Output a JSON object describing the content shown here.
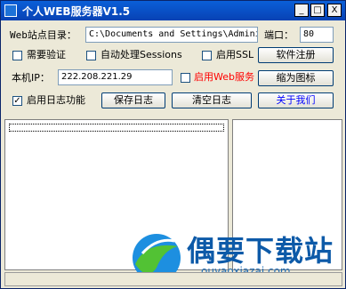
{
  "window": {
    "title": "个人WEB服务器V1.5"
  },
  "controls": {
    "minimize": "_",
    "maximize": "□",
    "close": "X"
  },
  "form": {
    "dir_label": "Web站点目录：",
    "dir_value": "C:\\Documents and Settings\\Admini",
    "port_label": "端口：",
    "port_value": "80",
    "cb_auth": "需要验证",
    "cb_session": "自动处理Sessions",
    "cb_ssl": "启用SSL",
    "btn_register": "软件注册",
    "ip_label": "本机IP：",
    "ip_value": "222.208.221.29",
    "cb_web": "启用Web服务",
    "btn_icon": "缩为图标",
    "cb_log": "启用日志功能",
    "cb_log_checked": "✓",
    "btn_save": "保存日志",
    "btn_clear": "清空日志",
    "btn_about": "关于我们"
  },
  "colors": {
    "web_service_label": "#ff0000",
    "about_label": "#0000ff"
  },
  "watermark": {
    "text": "偶要下载站",
    "subtext": "ouyaoxiazai.com"
  }
}
